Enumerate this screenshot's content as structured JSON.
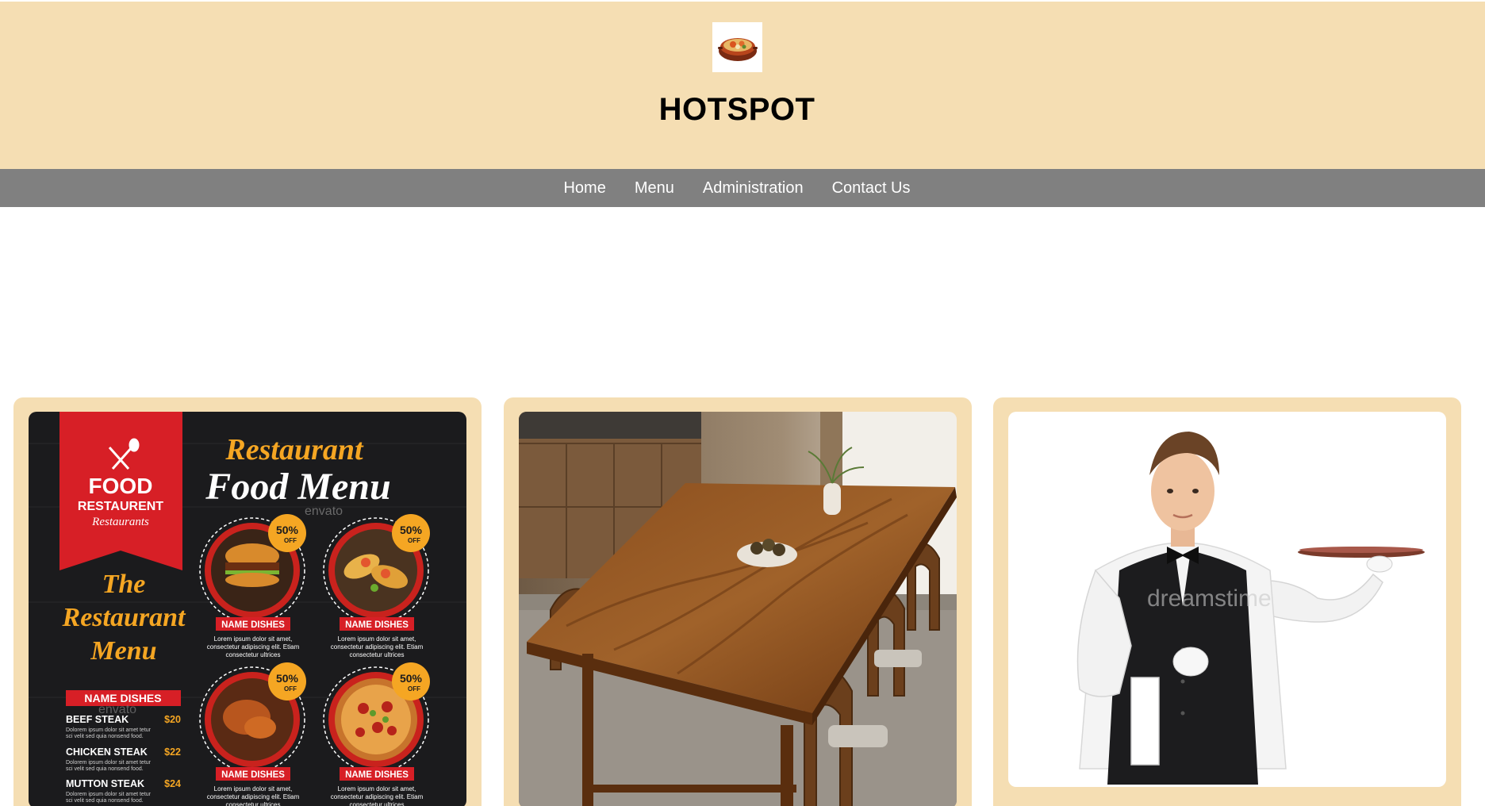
{
  "site": {
    "title": "HOTSPOT",
    "logo_icon": "food-bowl-logo-icon"
  },
  "nav": {
    "items": [
      {
        "label": "Home"
      },
      {
        "label": "Menu"
      },
      {
        "label": "Administration"
      },
      {
        "label": "Contact Us"
      }
    ]
  },
  "cards": [
    {
      "name": "food-menu-poster",
      "poster": {
        "banner_line1": "FOOD",
        "banner_line2": "RESTAURENT",
        "banner_line3": "Restaurants",
        "headline1": "Restaurant",
        "headline2": "Food Menu",
        "side_title1": "The",
        "side_title2": "Restaurant",
        "side_title3": "Menu",
        "list_header": "NAME DISHES",
        "dishes": [
          {
            "name": "BEEF STEAK",
            "price": "$20"
          },
          {
            "name": "CHICKEN STEAK",
            "price": "$22"
          },
          {
            "name": "MUTTON STEAK",
            "price": "$24"
          }
        ],
        "badge": "50%",
        "badge_sub": "OFF",
        "dish_label": "NAME DISHES",
        "lorem": "Lorem ipsum dolor sit amet,",
        "lorem2": "consectetur adipiscing elit. Etiam",
        "lorem3": "consectetur ultrices",
        "list_lorem1": "Dolorem ipsum dolor sit amet tetur",
        "list_lorem2": "sci velit sed quia nonsend food.",
        "watermark": "envato"
      }
    },
    {
      "name": "dining-table-photo"
    },
    {
      "name": "waiter-photo",
      "watermark": "dreamstime"
    }
  ],
  "colors": {
    "header_bg": "#f5deb3",
    "nav_bg": "#808080",
    "poster_red": "#d71f26",
    "poster_orange": "#f5a623",
    "poster_dark": "#1b1b1d"
  }
}
